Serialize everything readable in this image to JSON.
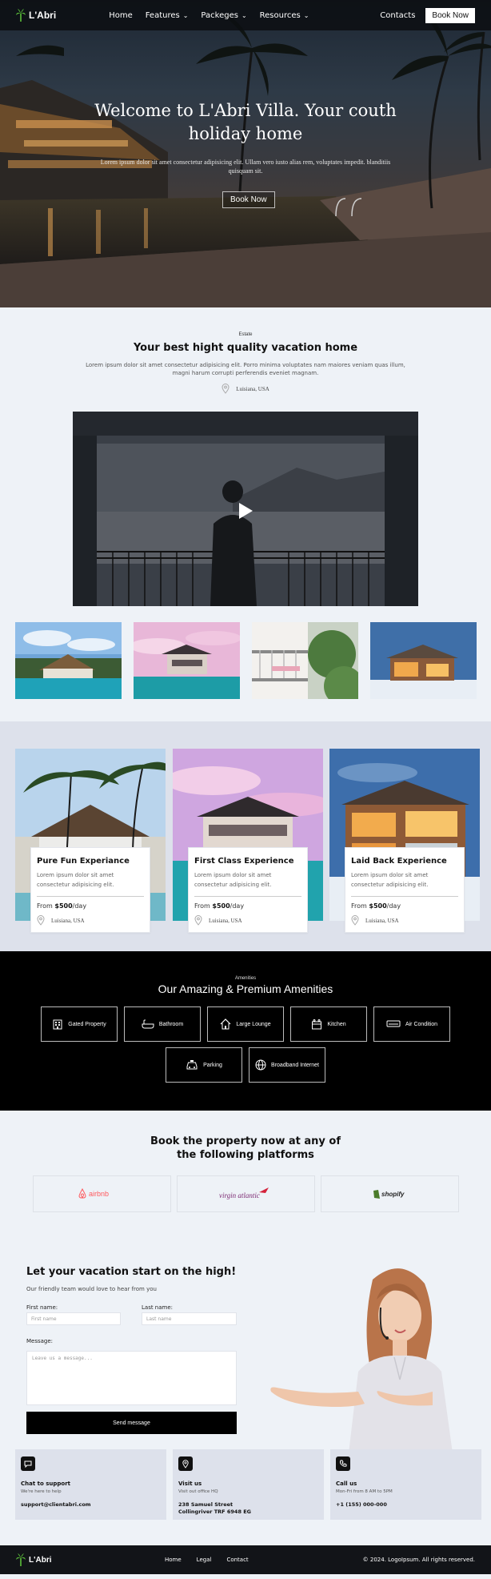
{
  "brand": {
    "name": "L'Abri"
  },
  "nav": {
    "items": [
      "Home",
      "Features",
      "Packeges",
      "Resources"
    ],
    "contacts": "Contacts",
    "book": "Book Now"
  },
  "hero": {
    "title": "Welcome to L'Abri Villa. Your couth holiday home",
    "subtitle": "Lorem ipsum dolor sit amet consectetur adipisicing elit. Ullam vero iusto alias rem, voluptates impedit. blanditiis quisquam sit.",
    "cta": "Book Now"
  },
  "estate": {
    "eyebrow": "Estate",
    "title": "Your best hight quality vacation home",
    "text": "Lorem ipsum dolor sit amet consectetur adipisicing elit. Porro minima voluptates nam maiores veniam quas illum, magni harum corrupti perferendis eveniet magnam.",
    "location": "Luisiana, USA"
  },
  "experiences": [
    {
      "title": "Pure Fun Experiance",
      "text": "Lorem ipsum dolor sit amet consectetur adipisicing elit.",
      "price_prefix": "From ",
      "price": "$500",
      "price_suffix": "/day",
      "location": "Luisiana, USA"
    },
    {
      "title": "First Class Experience",
      "text": "Lorem ipsum dolor sit amet consectetur adipisicing elit.",
      "price_prefix": "From ",
      "price": "$500",
      "price_suffix": "/day",
      "location": "Luisiana, USA"
    },
    {
      "title": "Laid Back Experience",
      "text": "Lorem ipsum dolor sit amet consectetur adipisicing elit.",
      "price_prefix": "From ",
      "price": "$500",
      "price_suffix": "/day",
      "location": "Luisiana, USA"
    }
  ],
  "amenities": {
    "eyebrow": "Amenities",
    "title": "Our Amazing & Premium Amenities",
    "items": [
      {
        "label": "Gated Property",
        "icon": "building-icon"
      },
      {
        "label": "Bathroom",
        "icon": "bathtub-icon"
      },
      {
        "label": "Large Lounge",
        "icon": "house-icon"
      },
      {
        "label": "Kitchen",
        "icon": "stove-icon"
      },
      {
        "label": "Air Condition",
        "icon": "air-conditioner-icon"
      },
      {
        "label": "Parking",
        "icon": "car-icon"
      },
      {
        "label": "Broadband Internet",
        "icon": "globe-icon"
      }
    ]
  },
  "platforms": {
    "title_line1": "Book the property now at any of",
    "title_line2": "the following platforms",
    "logos": [
      {
        "name": "airbnb",
        "color": "#ff5a5f"
      },
      {
        "name": "virgin atlantic",
        "color": "#7d2a73"
      },
      {
        "name": "shopify",
        "color": "#4a7b2a"
      }
    ]
  },
  "contact": {
    "title": "Let your vacation start on the high!",
    "subtitle": "Our friendly team would love to hear from you",
    "first_label": "First name:",
    "first_placeholder": "First name",
    "last_label": "Last name:",
    "last_placeholder": "Last name",
    "message_label": "Message:",
    "message_placeholder": "Leave us a message...",
    "send": "Send message"
  },
  "info": [
    {
      "title": "Chat to support",
      "sub": "We're here to help",
      "value1": "support@clientabri.com",
      "value2": ""
    },
    {
      "title": "Visit us",
      "sub": "Visit out office HQ",
      "value1": "238 Samuel Street",
      "value2": "Collingriver TRF 6948 EG"
    },
    {
      "title": "Call us",
      "sub": "Mon-Fri from 8 AM to 5PM",
      "value1": "+1 (155) 000-000",
      "value2": ""
    }
  ],
  "footer": {
    "links": [
      "Home",
      "Legal",
      "Contact"
    ],
    "copyright": "© 2024. LogoIpsum. All rights reserved."
  },
  "colors": {
    "accent": "#000000",
    "panel": "#dde1eb",
    "page": "#eef2f7"
  }
}
